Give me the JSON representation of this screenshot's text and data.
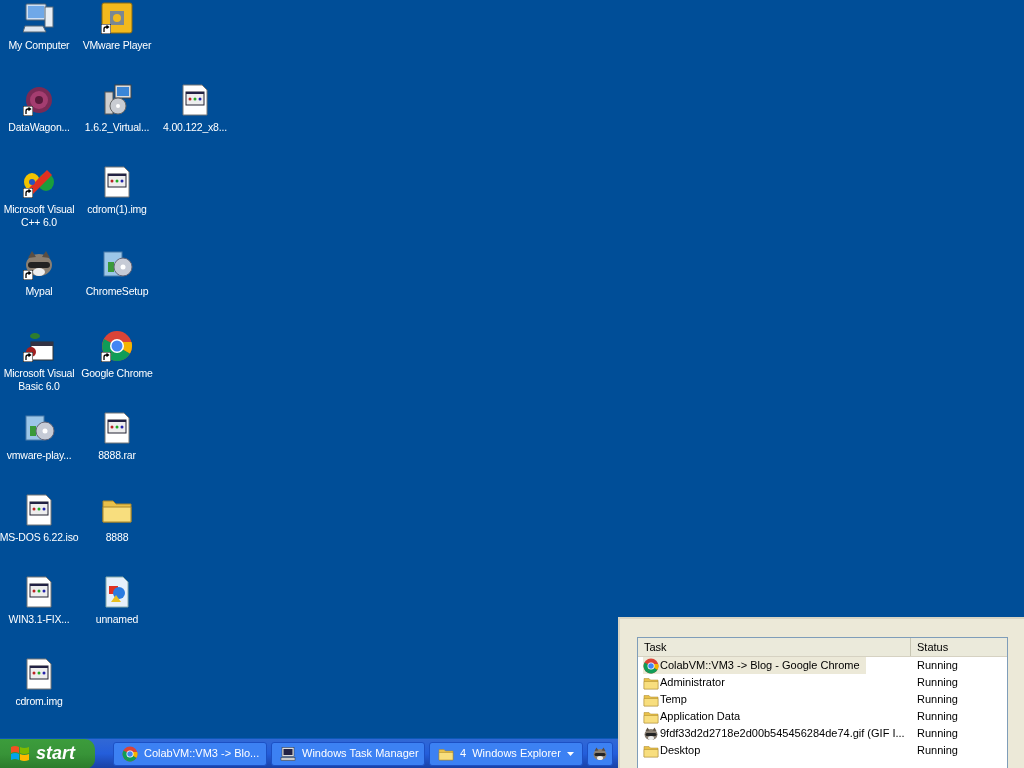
{
  "desktop": {
    "rows": [
      [
        {
          "label": "My Computer",
          "kind": "computer",
          "shortcut": false
        },
        {
          "label": "VMware Player",
          "kind": "vmware",
          "shortcut": true
        }
      ],
      [
        {
          "label": "DataWagon...",
          "kind": "datawagon",
          "shortcut": true
        },
        {
          "label": "1.6.2_Virtual...",
          "kind": "setup",
          "shortcut": false
        },
        {
          "label": "4.00.122_x8...",
          "kind": "document",
          "shortcut": false
        }
      ],
      [
        {
          "label": "Microsoft Visual C++ 6.0",
          "kind": "vcpp",
          "shortcut": true
        },
        {
          "label": "cdrom(1).img",
          "kind": "document",
          "shortcut": false
        }
      ],
      [
        {
          "label": "Mypal",
          "kind": "mypal",
          "shortcut": true
        },
        {
          "label": "ChromeSetup",
          "kind": "installer",
          "shortcut": false
        }
      ],
      [
        {
          "label": "Microsoft Visual Basic 6.0",
          "kind": "vb",
          "shortcut": true
        },
        {
          "label": "Google Chrome",
          "kind": "chrome",
          "shortcut": true
        }
      ],
      [
        {
          "label": "vmware-play...",
          "kind": "installer",
          "shortcut": false
        },
        {
          "label": "8888.rar",
          "kind": "document",
          "shortcut": false
        }
      ],
      [
        {
          "label": "MS-DOS 6.22.iso",
          "kind": "document",
          "shortcut": false
        },
        {
          "label": "8888",
          "kind": "folder",
          "shortcut": false
        }
      ],
      [
        {
          "label": "WIN3.1-FIX...",
          "kind": "document",
          "shortcut": false
        },
        {
          "label": "unnamed",
          "kind": "image",
          "shortcut": false
        }
      ],
      [
        {
          "label": "cdrom.img",
          "kind": "document",
          "shortcut": false
        }
      ]
    ]
  },
  "taskbar": {
    "start": "start",
    "buttons": [
      {
        "label": "ColabVM::VM3 -> Blo...",
        "kind": "chrome"
      },
      {
        "label": "Windows Task Manager",
        "kind": "monitor"
      },
      {
        "count": "4",
        "label": "Windows Explorer",
        "kind": "folder"
      },
      {
        "kind": "mypal"
      }
    ]
  },
  "task_manager": {
    "columns": [
      "Task",
      "Status"
    ],
    "rows": [
      {
        "task": "ColabVM::VM3 -> Blog - Google Chrome",
        "kind": "chrome",
        "status": "Running",
        "selected": true
      },
      {
        "task": "Administrator",
        "kind": "folder",
        "status": "Running",
        "selected": false
      },
      {
        "task": "Temp",
        "kind": "folder",
        "status": "Running",
        "selected": false
      },
      {
        "task": "Application Data",
        "kind": "folder",
        "status": "Running",
        "selected": false
      },
      {
        "task": "9fdf33d2d2718e2d00b545456284de74.gif (GIF I...",
        "kind": "mypal",
        "status": "Running",
        "selected": false
      },
      {
        "task": "Desktop",
        "kind": "folder",
        "status": "Running",
        "selected": false
      }
    ]
  }
}
